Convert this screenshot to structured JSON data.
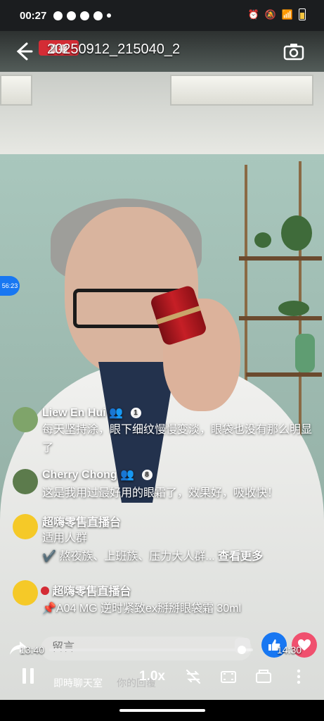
{
  "status_bar": {
    "time": "00:27",
    "battery_color": "#f4c542"
  },
  "header": {
    "live_label": "直播",
    "title": "20250912_215040_2",
    "icons": [
      "back-icon",
      "camera-icon"
    ]
  },
  "side_indicator": "56:23",
  "comments": [
    {
      "name": "Liew En Hui",
      "badge": "1",
      "text": "每天坚持涂，眼下细纹慢慢变淡，眼袋也没有那么明显了"
    },
    {
      "name": "Cherry Chong",
      "badge": "8",
      "text": "这是我用过最好用的眼霜了，效果好，吸收快！"
    },
    {
      "name": "超嗨零售直播台",
      "line1": "适用人群",
      "line2_prefix": "✔️ 熬夜族、上班族、压力大人群...",
      "see_more": "查看更多"
    },
    {
      "name": "超嗨零售直播台",
      "text": "📌A04  MG 逆时紧致ex掰掰眼袋霜 30ml"
    }
  ],
  "comment_box": {
    "placeholder": "留言....."
  },
  "playback": {
    "current_time": "13:40",
    "total_time": "14:30",
    "progress": 0.945,
    "speed": "1.0x"
  },
  "tabs": {
    "chat": "即時聊天室",
    "replies": "你的回覆"
  },
  "colors": {
    "facebook_blue": "#1877f2",
    "love_pink": "#f0506e",
    "live_red": "#d42c35"
  }
}
